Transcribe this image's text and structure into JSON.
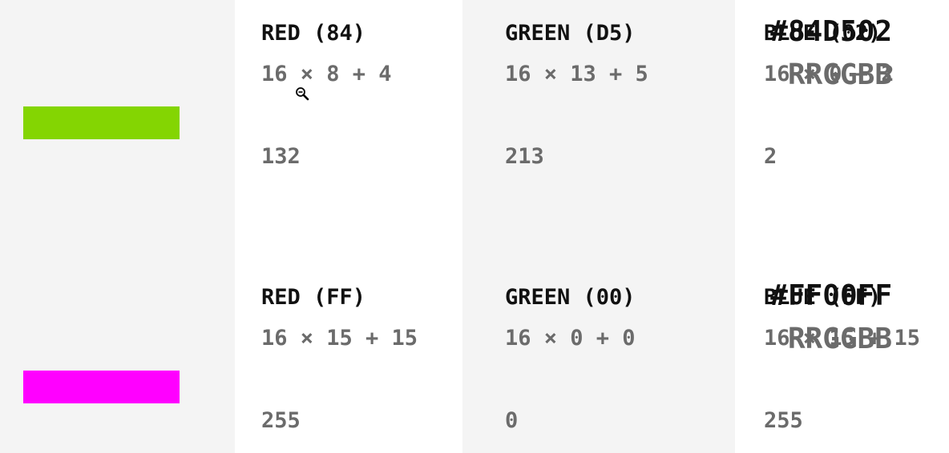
{
  "colors": [
    {
      "hex": "#84D502",
      "pattern": "RRGGBB",
      "swatch_color": "#84D502",
      "red": {
        "label": "RED (84)",
        "formula": "16 × 8 + 4",
        "result": "132"
      },
      "green": {
        "label": "GREEN (D5)",
        "formula": "16 × 13 + 5",
        "result": "213"
      },
      "blue": {
        "label": "BLUE (02)",
        "formula": "16 × 0 + 2",
        "result": "2"
      }
    },
    {
      "hex": "#FF00FF",
      "pattern": "RRGGBB",
      "swatch_color": "#FF00FF",
      "red": {
        "label": "RED (FF)",
        "formula": "16 × 15 + 15",
        "result": "255"
      },
      "green": {
        "label": "GREEN (00)",
        "formula": "16 × 0 + 0",
        "result": "0"
      },
      "blue": {
        "label": "BLUE (FF)",
        "formula": "16 × 15 + 15",
        "result": "255"
      }
    }
  ],
  "cursor_icon": "zoom-out-cursor-icon"
}
